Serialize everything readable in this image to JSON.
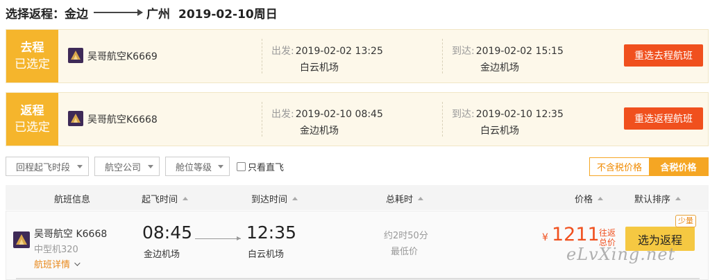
{
  "header": {
    "prefix": "选择返程：",
    "from": "金边",
    "to": "广州",
    "date": "2019-02-10周日"
  },
  "legs": [
    {
      "badge_line1": "去程",
      "badge_line2": "已选定",
      "airline": "吴哥航空K6669",
      "dep_label": "出发:",
      "dep_time": "2019-02-02 13:25",
      "dep_airport": "白云机场",
      "arr_label": "到达:",
      "arr_time": "2019-02-02 15:15",
      "arr_airport": "金边机场",
      "button": "重选去程航班"
    },
    {
      "badge_line1": "返程",
      "badge_line2": "已选定",
      "airline": "吴哥航空K6668",
      "dep_label": "出发:",
      "dep_time": "2019-02-10 08:45",
      "dep_airport": "金边机场",
      "arr_label": "到达:",
      "arr_time": "2019-02-10 12:35",
      "arr_airport": "白云机场",
      "button": "重选返程航班"
    }
  ],
  "filters": {
    "time_period": "回程起飞时段",
    "airline": "航空公司",
    "cabin": "舱位等级",
    "direct_only": "只看直飞",
    "direct_checked": false
  },
  "tax": {
    "excl": "不含税价格",
    "incl": "含税价格",
    "selected": "incl"
  },
  "table": {
    "headers": {
      "flight_info": "航班信息",
      "dep_time": "起飞时间",
      "arr_time": "到达时间",
      "duration": "总耗时",
      "price": "价格",
      "sort": "默认排序"
    },
    "rows": [
      {
        "airline": "吴哥航空 K6668",
        "model": "中型机320",
        "details": "航班详情",
        "dep_time": "08:45",
        "dep_airport": "金边机场",
        "arr_time": "12:35",
        "arr_airport": "白云机场",
        "duration": "约2时50分",
        "tag": "最低价",
        "currency": "¥",
        "price": "1211",
        "price_note": "往返总价",
        "button": "选为返程",
        "stock": "少量"
      }
    ]
  },
  "watermark": "eLvXing.net",
  "colors": {
    "badge": "#f5b52c",
    "reselect": "#f0501e",
    "price": "#f0501e",
    "choose": "#f5c842",
    "accent": "#f5a623"
  }
}
